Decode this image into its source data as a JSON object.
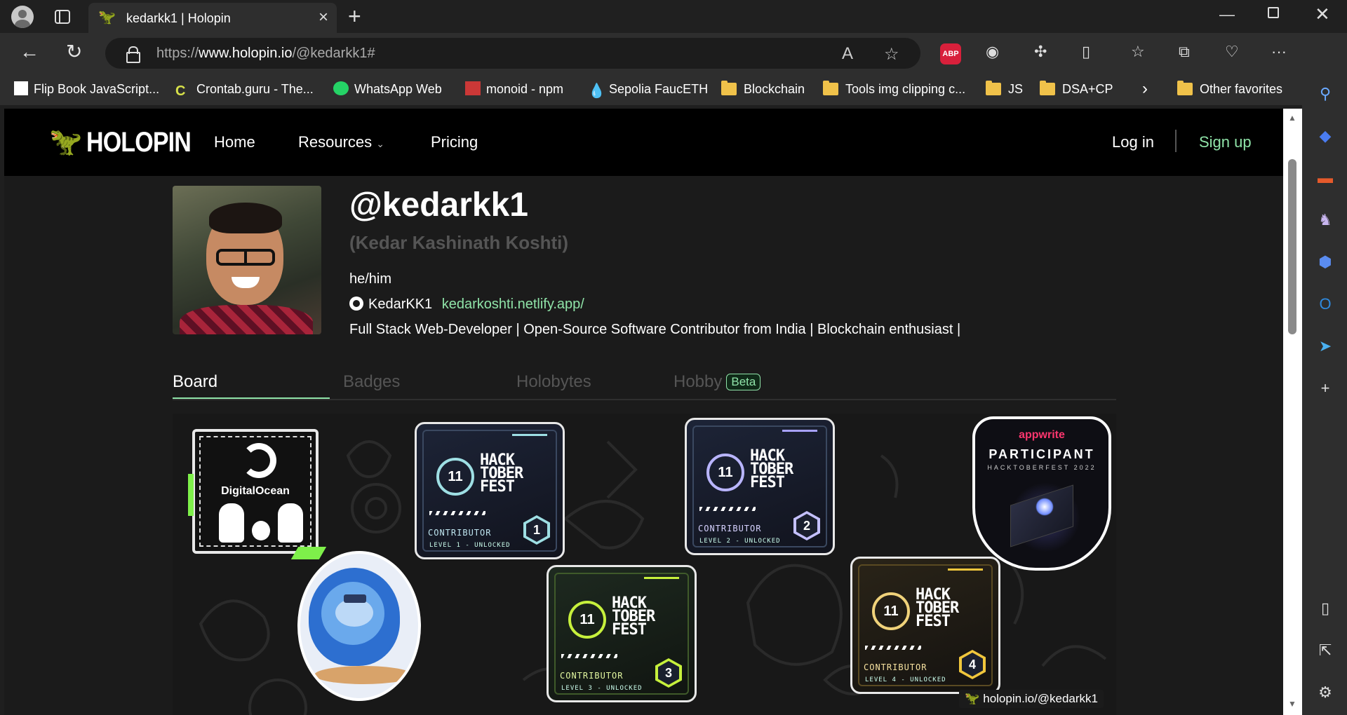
{
  "browser": {
    "tab_title": "kedarkk1 | Holopin",
    "url_prefix": "https://",
    "url_domain": "www.holopin.io",
    "url_path": "/@kedarkk1#",
    "bookmarks": [
      {
        "label": "Flip Book JavaScript...",
        "icon": "flipbook-icon"
      },
      {
        "label": "Crontab.guru - The...",
        "icon": "crontab-icon"
      },
      {
        "label": "WhatsApp Web",
        "icon": "whatsapp-icon"
      },
      {
        "label": "monoid - npm",
        "icon": "npm-icon"
      },
      {
        "label": "Sepolia FaucETH",
        "icon": "ethereum-drop-icon"
      },
      {
        "label": "Blockchain",
        "icon": "folder-icon"
      },
      {
        "label": "Tools img clipping c...",
        "icon": "folder-icon"
      },
      {
        "label": "JS",
        "icon": "folder-icon"
      },
      {
        "label": "DSA+CP",
        "icon": "folder-icon"
      }
    ],
    "other_favorites": "Other favorites",
    "abp_label": "ABP"
  },
  "site": {
    "logo_text": "HOLOPIN",
    "nav": {
      "home": "Home",
      "resources": "Resources",
      "pricing": "Pricing",
      "login": "Log in",
      "signup": "Sign up"
    },
    "brand_color": "#8fe3a8"
  },
  "profile": {
    "handle": "@kedarkk1",
    "name": "(Kedar Kashinath Koshti)",
    "pronouns": "he/him",
    "github_user": "KedarKK1",
    "website": "kedarkoshti.netlify.app/",
    "bio": "Full Stack Web-Developer | Open-Source Software Contributor from India | Blockchain enthusiast |"
  },
  "tabs": {
    "board": "Board",
    "badges": "Badges",
    "holobytes": "Holobytes",
    "hobby": "Hobby",
    "beta": "Beta"
  },
  "board": {
    "digitalocean": {
      "name": "DigitalOcean"
    },
    "hacktoberfest": [
      {
        "title": "HACK TOBER FEST",
        "role": "CONTRIBUTOR",
        "level_line": "LEVEL 1 - UNLOCKED",
        "level": "1"
      },
      {
        "title": "HACK TOBER FEST",
        "role": "CONTRIBUTOR",
        "level_line": "LEVEL 2 - UNLOCKED",
        "level": "2"
      },
      {
        "title": "HACK TOBER FEST",
        "role": "CONTRIBUTOR",
        "level_line": "LEVEL 3 - UNLOCKED",
        "level": "3"
      },
      {
        "title": "HACK TOBER FEST",
        "role": "CONTRIBUTOR",
        "level_line": "LEVEL 4 - UNLOCKED",
        "level": "4"
      }
    ],
    "appwrite": {
      "brand": "appwrite",
      "title": "PARTICIPANT",
      "subtitle": "HACKTOBERFEST 2022"
    },
    "watermark": "holopin.io/@kedarkk1"
  }
}
